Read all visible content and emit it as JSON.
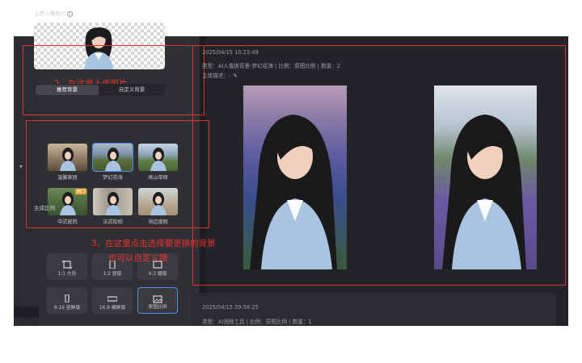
{
  "panel": {
    "upload_title": "上传人像照片",
    "info_icon": "info-icon",
    "tabs": [
      "推荐背景",
      "自定义背景"
    ],
    "backgrounds": [
      {
        "label": "温馨家居"
      },
      {
        "label": "梦幻花海"
      },
      {
        "label": "高山草原"
      },
      {
        "label": "中式庭院",
        "badge": "热门"
      },
      {
        "label": "法式街拍"
      },
      {
        "label": "海边度假"
      }
    ],
    "ratio_title": "生成比例",
    "ratios": [
      {
        "label": "1:1 方形",
        "icon": "square-frame-icon"
      },
      {
        "label": "1:2 竖版",
        "icon": "portrait-frame-icon"
      },
      {
        "label": "4:3 横版",
        "icon": "landscape-frame-icon"
      },
      {
        "label": "9:16 竖屏版",
        "icon": "tall-frame-icon"
      },
      {
        "label": "16:9 横屏版",
        "icon": "wide-frame-icon"
      },
      {
        "label": "原图比例",
        "icon": "image-frame-icon"
      }
    ]
  },
  "annotations": {
    "step2": "2、在这里上传照片",
    "step3_line1": "3、在这里点击选择要更换的背景",
    "step3_line2": "也可以自定义哦"
  },
  "results": [
    {
      "timestamp": "2025/04/15 10:23:49",
      "info": "类型：AI人像换背景-梦幻花海 | 比例：原图比例 | 数量：2",
      "subject": "主体描述：-",
      "edit_icon": "pencil-icon"
    },
    {
      "timestamp": "2025/04/15 09:58:25",
      "info": "类型：AI消除工具 | 比例：原图比例 | 数量：1"
    }
  ],
  "colors": {
    "accent": "#4e8cff",
    "annotation_red": "#e63030",
    "panel_bg": "#2f3034",
    "main_bg": "#232427"
  }
}
